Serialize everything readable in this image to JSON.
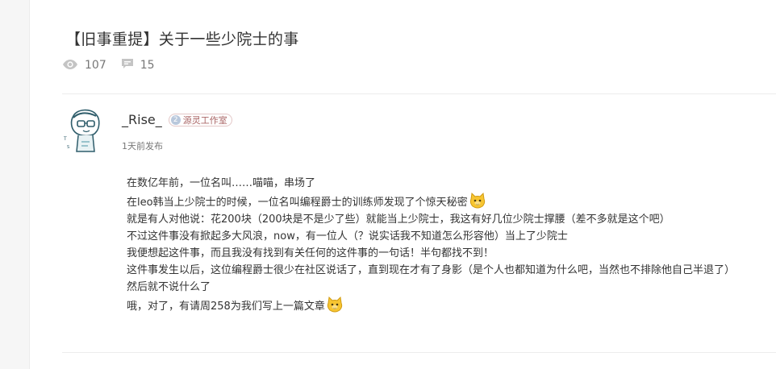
{
  "post": {
    "title": "【旧事重提】关于一些少院士的事",
    "views": "107",
    "comments": "15"
  },
  "author": {
    "name": "_Rise_",
    "badge_level": "2",
    "badge_text": "源灵工作室",
    "time": "1天前发布"
  },
  "content": {
    "lines": [
      "在数亿年前，一位名叫……喵喵，串场了",
      "在leo韩当上少院士的时候，一位名叫编程爵士的训练师发现了个惊天秘密",
      "就是有人对他说：花200块（200块是不是少了些）就能当上少院士，我这有好几位少院士撑腰（差不多就是这个吧）",
      "不过这件事没有掀起多大风浪，now，有一位人（？说实话我不知道怎么形容他）当上了少院士",
      "我便想起这件事，而且我没有找到有关任何的这件事的一句话！半句都找不到！",
      "这件事发生以后，这位编程爵士很少在社区说话了，直到现在才有了身影（是个人也都知道为什么吧，当然也不排除他自己半退了）",
      "然后就不说什么了",
      "哦，对了，有请周258为我们写上一篇文章"
    ]
  },
  "icons": {
    "views": "eye-icon",
    "comments": "comment-icon",
    "emoji": "cat-face-emoji-icon"
  }
}
